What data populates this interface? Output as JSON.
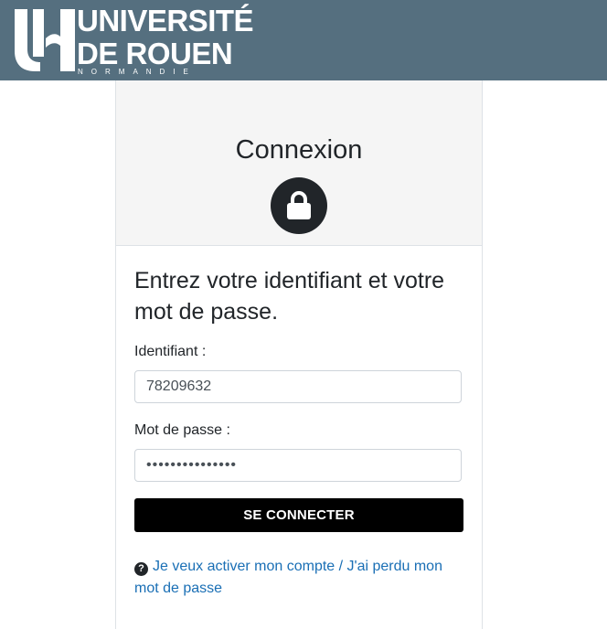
{
  "header": {
    "logo": {
      "line1": "UNIVERSITÉ",
      "line2": "DE ROUEN",
      "line3": "NORMANDIE"
    },
    "background_color": "#556f7f"
  },
  "login": {
    "title": "Connexion",
    "lock_icon": "lock-icon",
    "intro": "Entrez votre identifiant et votre mot de passe.",
    "username_label": "Identifiant :",
    "username_value": "78209632",
    "password_label": "Mot de passe :",
    "password_value": "•••••••••••••••",
    "submit_label": "SE CONNECTER",
    "help_icon": "question-circle-icon",
    "help_link": "Je veux activer mon compte / J'ai perdu mon mot de passe",
    "link_color": "#1a6fb5"
  }
}
